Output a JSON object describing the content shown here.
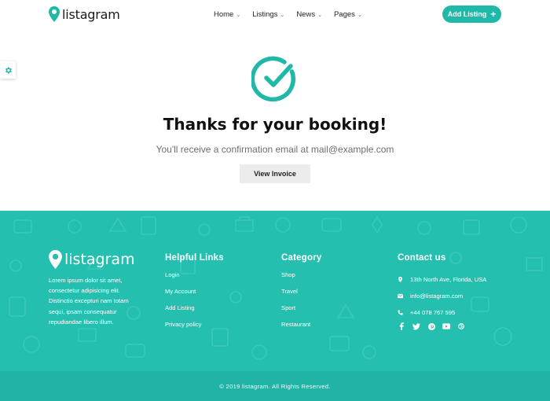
{
  "header": {
    "logo_text": "listagram",
    "nav": [
      {
        "label": "Home"
      },
      {
        "label": "Listings"
      },
      {
        "label": "News"
      },
      {
        "label": "Pages"
      }
    ],
    "add_listing_label": "Add Listing"
  },
  "main": {
    "title": "Thanks for your booking!",
    "subtitle": "You'll receive a confirmation email at mail@example.com",
    "button_label": "View Invoice"
  },
  "footer": {
    "logo_text": "listagram",
    "about": "Lorem ipsum dolor sit amet, consectetur adipisicing elit. Distinctio excepturi nam totam sequi, ipsam consequatur repudiandae libero illum.",
    "helpful_links": {
      "title": "Helpful Links",
      "items": [
        "Login",
        "My Account",
        "Add Listing",
        "Privacy policy"
      ]
    },
    "category": {
      "title": "Category",
      "items": [
        "Shop",
        "Travel",
        "Sport",
        "Restaurant"
      ]
    },
    "contact": {
      "title": "Contact us",
      "address": "13th North Ave, Florida, USA",
      "email": "info@listagram.com",
      "phone": "+44 078 767 595"
    },
    "social_icons": [
      "facebook-icon",
      "twitter-icon",
      "pinterest-icon",
      "youtube-icon",
      "dribbble-icon"
    ],
    "copyright": "© 2019 listagram. All Rights Reserved."
  },
  "colors": {
    "accent": "#20b8a9",
    "footer_bg": "#25bfb0",
    "bottom_bar": "#21b3a5"
  }
}
